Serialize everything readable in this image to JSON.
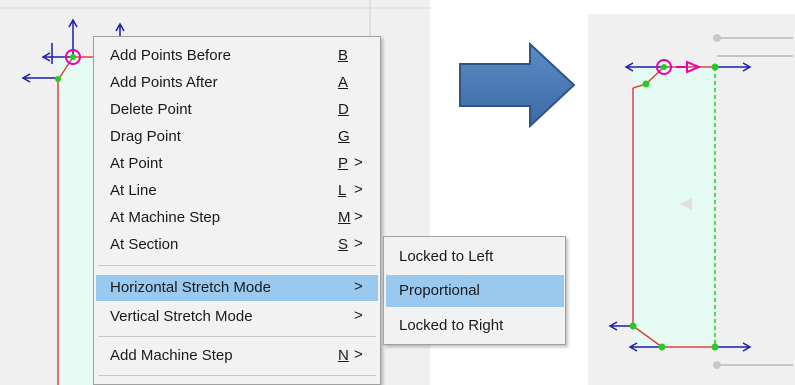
{
  "context_menu": {
    "items": [
      {
        "label": "Add Points Before",
        "key": "B",
        "submenu": false
      },
      {
        "label": "Add Points After",
        "key": "A",
        "submenu": false
      },
      {
        "label": "Delete Point",
        "key": "D",
        "submenu": false
      },
      {
        "label": "Drag Point",
        "key": "G",
        "submenu": false
      },
      {
        "label": "At Point",
        "key": "P",
        "submenu": true
      },
      {
        "label": "At Line",
        "key": "L",
        "submenu": true
      },
      {
        "label": "At Machine Step",
        "key": "M",
        "submenu": true
      },
      {
        "label": "At Section",
        "key": "S",
        "submenu": true
      },
      {
        "label": "Horizontal Stretch Mode",
        "key": "",
        "submenu": true,
        "highlighted": true
      },
      {
        "label": "Vertical Stretch Mode",
        "key": "",
        "submenu": true
      },
      {
        "label": "Add Machine Step",
        "key": "N",
        "submenu": true
      }
    ],
    "arrow_glyph": ">"
  },
  "stretch_submenu": {
    "items": [
      {
        "label": "Locked to Left"
      },
      {
        "label": "Proportional",
        "highlighted": true
      },
      {
        "label": "Locked to Right"
      }
    ]
  },
  "colors": {
    "menu_highlight": "#99c9ef",
    "profile_fill": "#e6faf4",
    "profile_edge": "#e04040",
    "point_green": "#22cc22",
    "axis_blue": "#1a1aaa",
    "selection_magenta": "#ee00aa",
    "arrow_blue": "#4a7bb5"
  }
}
